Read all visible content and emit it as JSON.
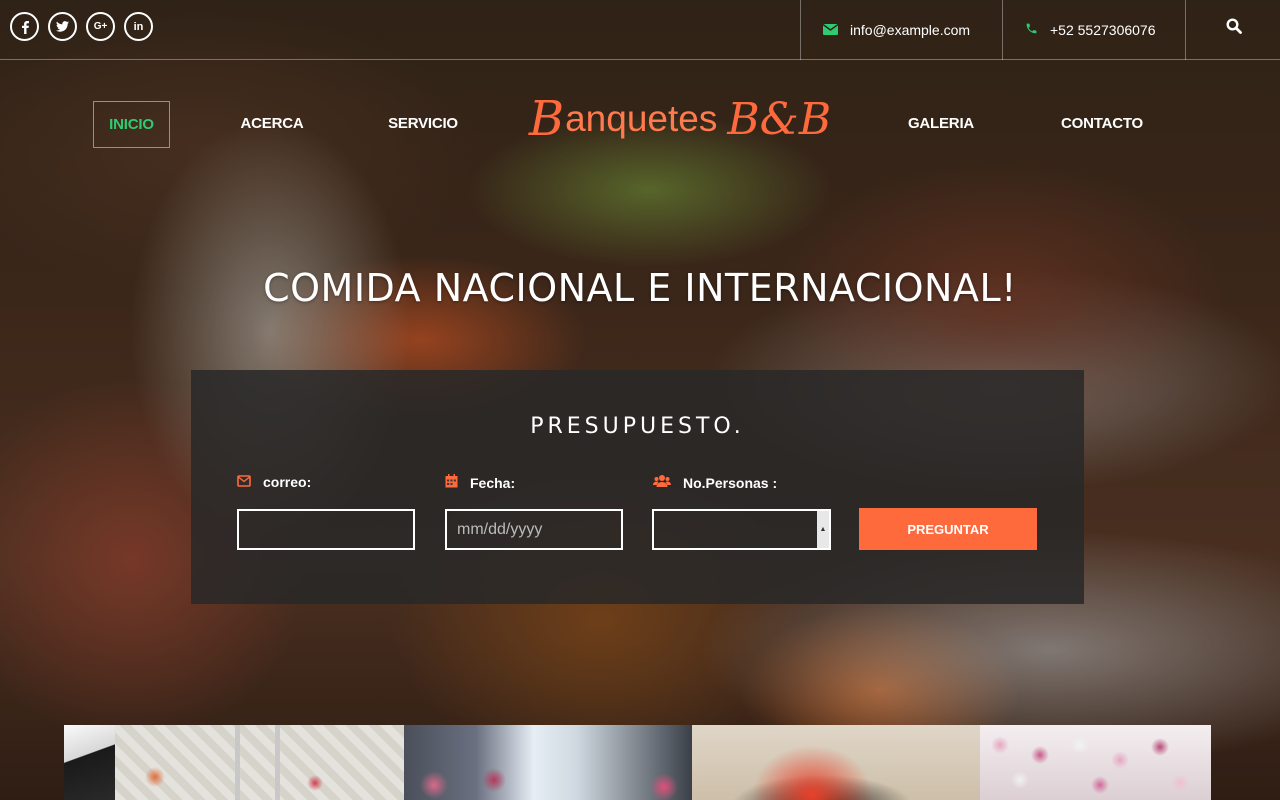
{
  "topbar": {
    "socials": [
      {
        "icon": "facebook-icon",
        "glyph": "f"
      },
      {
        "icon": "twitter-icon",
        "glyph": "🐦"
      },
      {
        "icon": "google-plus-icon",
        "glyph": "G+"
      },
      {
        "icon": "linkedin-icon",
        "glyph": "in"
      }
    ],
    "email": "info@example.com",
    "phone": "+52 5527306076",
    "search_icon": "search-icon"
  },
  "nav": {
    "items": [
      "INICIO",
      "ACERCA",
      "SERVICIO",
      "GALERIA",
      "CONTACTO"
    ],
    "active": "INICIO",
    "brand": {
      "first_letter": "B",
      "word": "anquetes",
      "suffix": "B&B"
    }
  },
  "hero": {
    "headline": "COMIDA NACIONAL E INTERNACIONAL!"
  },
  "budget_form": {
    "title": "PRESUPUESTO.",
    "email_label": "correo:",
    "date_label": "Fecha:",
    "date_placeholder": "mm/dd/yyyy",
    "people_label": "No.Personas :",
    "submit_label": "PREGUNTAR"
  },
  "colors": {
    "accent": "#ff6a3d",
    "active_nav": "#2ecc71",
    "contact_icon": "#2ecc71"
  },
  "gallery": {
    "thumbnails": [
      "gallery-thumb-1",
      "gallery-thumb-2",
      "gallery-thumb-3",
      "gallery-thumb-4"
    ]
  }
}
